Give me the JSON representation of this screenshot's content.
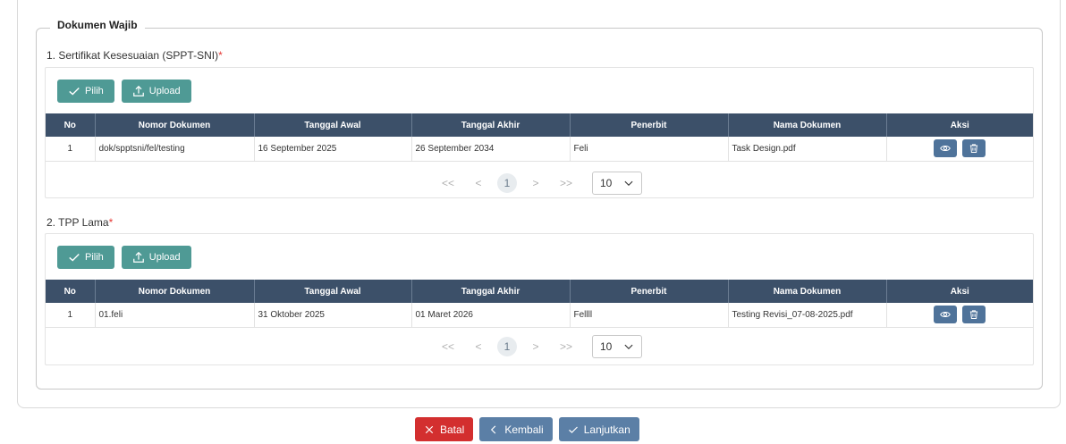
{
  "fieldset": {
    "legend": "Dokumen Wajib"
  },
  "sections": [
    {
      "title": "1. Sertifikat Kesesuaian (SPPT-SNI)",
      "required_mark": "*",
      "buttons": {
        "pilih": "Pilih",
        "upload": "Upload"
      },
      "columns": [
        "No",
        "Nomor Dokumen",
        "Tanggal Awal",
        "Tanggal Akhir",
        "Penerbit",
        "Nama Dokumen",
        "Aksi"
      ],
      "rows": [
        {
          "no": "1",
          "nomor": "dok/spptsni/fel/testing",
          "awal": "16 September 2025",
          "akhir": "26 September 2034",
          "penerbit": "Feli",
          "nama": "Task Design.pdf"
        }
      ],
      "pagination": {
        "first": "<<",
        "prev": "<",
        "current": "1",
        "next": ">",
        "last": ">>",
        "page_size": "10"
      }
    },
    {
      "title": "2. TPP Lama",
      "required_mark": "*",
      "buttons": {
        "pilih": "Pilih",
        "upload": "Upload"
      },
      "columns": [
        "No",
        "Nomor Dokumen",
        "Tanggal Awal",
        "Tanggal Akhir",
        "Penerbit",
        "Nama Dokumen",
        "Aksi"
      ],
      "rows": [
        {
          "no": "1",
          "nomor": "01.feli",
          "awal": "31 Oktober 2025",
          "akhir": "01 Maret 2026",
          "penerbit": "Fellll",
          "nama": "Testing Revisi_07-08-2025.pdf"
        }
      ],
      "pagination": {
        "first": "<<",
        "prev": "<",
        "current": "1",
        "next": ">",
        "last": ">>",
        "page_size": "10"
      }
    }
  ],
  "footer": {
    "batal": "Batal",
    "kembali": "Kembali",
    "lanjutkan": "Lanjutkan"
  },
  "colors": {
    "teal": "#4f9a95",
    "header": "#3c5069",
    "action": "#4f739a",
    "danger": "#d32f2f",
    "secondary": "#5b7fa6"
  },
  "icons": {
    "pilih": "check-icon",
    "upload": "upload-icon",
    "view": "eye-icon",
    "delete": "trash-icon",
    "batal": "x-icon",
    "kembali": "chevron-left-icon",
    "lanjutkan": "check-icon",
    "page_size": "chevron-down-icon"
  }
}
